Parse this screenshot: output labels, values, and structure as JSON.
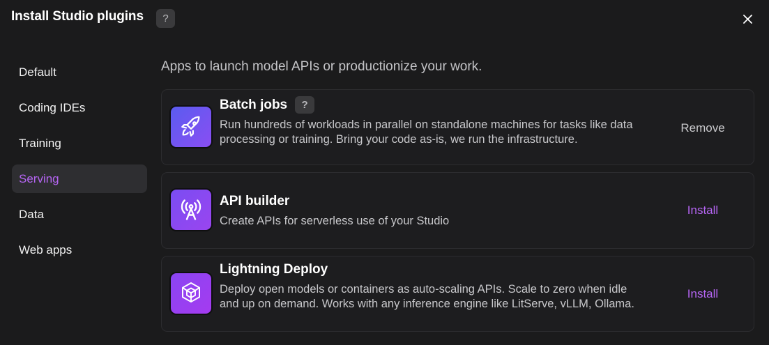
{
  "dialog": {
    "title": "Install Studio plugins",
    "help_glyph": "?",
    "close_glyph": "✕"
  },
  "sidebar": {
    "items": [
      {
        "label": "Default",
        "active": false
      },
      {
        "label": "Coding IDEs",
        "active": false
      },
      {
        "label": "Training",
        "active": false
      },
      {
        "label": "Serving",
        "active": true
      },
      {
        "label": "Data",
        "active": false
      },
      {
        "label": "Web apps",
        "active": false
      }
    ]
  },
  "main": {
    "subtitle": "Apps to launch model APIs or productionize your work.",
    "plugins": [
      {
        "title": "Batch jobs",
        "has_help": true,
        "description": "Run hundreds of workloads in parallel on standalone machines for tasks like data processing or training. Bring your code as-is, we run the infrastructure.",
        "action": "Remove",
        "icon": "rocket-icon"
      },
      {
        "title": "API builder",
        "has_help": false,
        "description": "Create APIs for serverless use of your Studio",
        "action": "Install",
        "icon": "broadcast-tower-icon"
      },
      {
        "title": "Lightning Deploy",
        "has_help": false,
        "description": "Deploy open models or containers as auto-scaling APIs. Scale to zero when idle and up on demand. Works with any inference engine like LitServe, vLLM, Ollama.",
        "action": "Install",
        "icon": "cube-cluster-icon"
      }
    ]
  },
  "colors": {
    "background": "#1b1b1c",
    "accent": "#b565f3",
    "icon_gradient_start": "#5b5cf0",
    "icon_gradient_end": "#a53bf0"
  }
}
